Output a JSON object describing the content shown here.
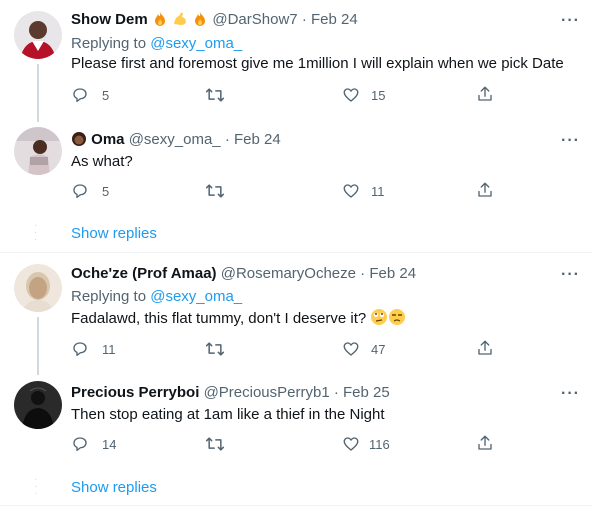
{
  "tweets": [
    {
      "name": "Show Dem",
      "name_emojis": [
        "fire",
        "flexed-biceps",
        "fire"
      ],
      "handle": "@DarShow7",
      "date": "Feb 24",
      "replying_prefix": "Replying to",
      "replying_handle": "@sexy_oma_",
      "text": "Please first and foremost give me 1million I will explain when we pick Date",
      "replies": "5",
      "retweets": "",
      "likes": "15"
    },
    {
      "name": "Oma",
      "handle": "@sexy_oma_",
      "date": "Feb 24",
      "text": "As what?",
      "replies": "5",
      "retweets": "",
      "likes": "11"
    },
    {
      "name": "Oche'ze (Prof Amaa)",
      "handle": "@RosemaryOcheze",
      "date": "Feb 24",
      "replying_prefix": "Replying to",
      "replying_handle": "@sexy_oma_",
      "text": "Fadalawd, this flat tummy, don't I deserve it?",
      "replies": "11",
      "retweets": "",
      "likes": "47"
    },
    {
      "name": "Precious Perryboi",
      "handle": "@PreciousPerryb1",
      "date": "Feb 25",
      "text": "Then stop eating at 1am like a thief in the Night",
      "replies": "14",
      "retweets": "",
      "likes": "116"
    }
  ],
  "show_replies": [
    "Show replies",
    "Show replies"
  ],
  "separator": "·",
  "colors": {
    "accent": "#1d9bf0",
    "muted": "#536471",
    "line": "#cfd9de",
    "divider": "#eff3f4"
  }
}
